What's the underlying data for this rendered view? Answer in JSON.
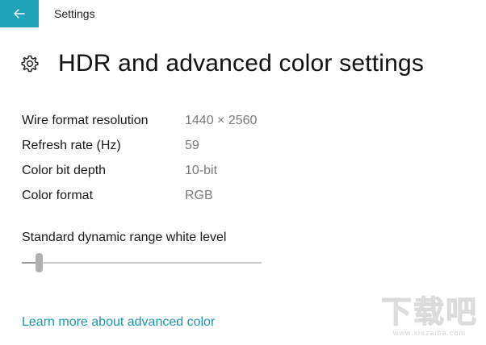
{
  "window": {
    "app_title": "Settings",
    "accent_color": "#1ea3b8"
  },
  "icons": {
    "back": "back-arrow-icon",
    "header": "gear-icon"
  },
  "header": {
    "title": "HDR and advanced color settings"
  },
  "display_info": [
    {
      "label": "Wire format resolution",
      "value": "1440 × 2560"
    },
    {
      "label": "Refresh rate (Hz)",
      "value": "59"
    },
    {
      "label": "Color bit depth",
      "value": "10-bit"
    },
    {
      "label": "Color format",
      "value": "RGB"
    }
  ],
  "sdr_slider": {
    "label": "Standard dynamic range white level",
    "level_fraction": 0.07
  },
  "link": {
    "text": "Learn more about advanced color",
    "color": "#1a9aaa"
  },
  "watermark": {
    "text": "下载吧",
    "url": "www.xiazaiba.com"
  }
}
